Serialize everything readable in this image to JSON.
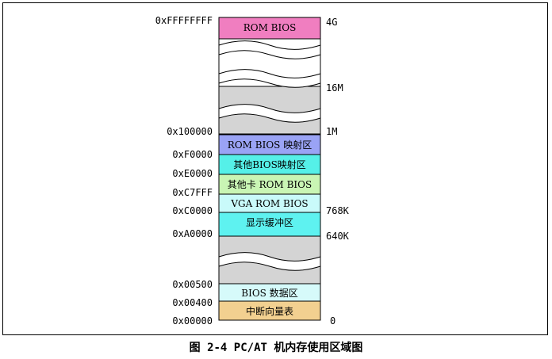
{
  "figure": {
    "caption": "图 2-4 PC/AT 机内存使用区域图"
  },
  "address_labels": [
    "0xFFFFFFFF",
    "0x100000",
    "0xF0000",
    "0xE0000",
    "0xC7FFF",
    "0xC0000",
    "0xA0000",
    "0x00500",
    "0x00400",
    "0x00000"
  ],
  "size_labels": [
    "4G",
    "16M",
    "1M",
    "768K",
    "640K",
    "0"
  ],
  "blocks": [
    {
      "label": "ROM BIOS",
      "color": "#f07ec0"
    },
    {
      "label": "ROM BIOS 映射区",
      "color": "#9aa3f5"
    },
    {
      "label": "其他BIOS映射区",
      "color": "#55f0e8"
    },
    {
      "label": "其他卡 ROM BIOS",
      "color": "#c9f5b4"
    },
    {
      "label": "VGA ROM BIOS",
      "color": "#c9fafa"
    },
    {
      "label": "显示缓冲区",
      "color": "#5ef2f0"
    },
    {
      "label": "BIOS 数据区",
      "color": "#d6fafa"
    },
    {
      "label": "中断向量表",
      "color": "#f2d090"
    }
  ],
  "colors": {
    "gap_gray": "#d4d4d4",
    "white": "#ffffff",
    "border": "#000000"
  }
}
